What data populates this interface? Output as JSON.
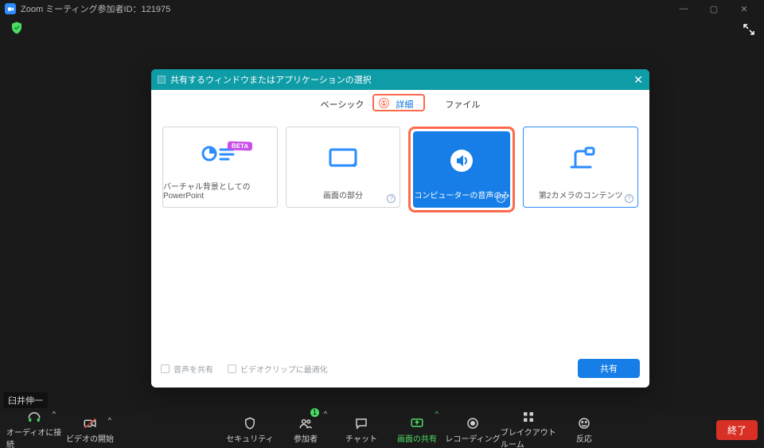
{
  "window": {
    "title": "Zoom ミーティング参加者ID：121975",
    "min": "—",
    "max": "▢",
    "close": "✕"
  },
  "participant_overlay": "臼井伸一",
  "toolbar": {
    "audio": "オーディオに接続",
    "video": "ビデオの開始",
    "security": "セキュリティ",
    "participants": "参加者",
    "participants_count": "1",
    "chat": "チャット",
    "share": "画面の共有",
    "record": "レコーディング",
    "breakout": "ブレイクアウトルーム",
    "reactions": "反応",
    "end": "終了"
  },
  "modal": {
    "title": "共有するウィンドウまたはアプリケーションの選択",
    "tabs": {
      "basic": "ベーシック",
      "advanced": "詳細",
      "file": "ファイル"
    },
    "marker_number": "①",
    "cards": {
      "vbg_ppt": "バーチャル背景としてのPowerPoint",
      "vbg_beta": "BETA",
      "portion": "画面の部分",
      "audio_only": "コンピューターの音声のみ",
      "second_cam": "第2カメラのコンテンツ"
    },
    "footer": {
      "share_audio": "音声を共有",
      "optimize_video": "ビデオクリップに最適化",
      "share_btn": "共有"
    }
  }
}
